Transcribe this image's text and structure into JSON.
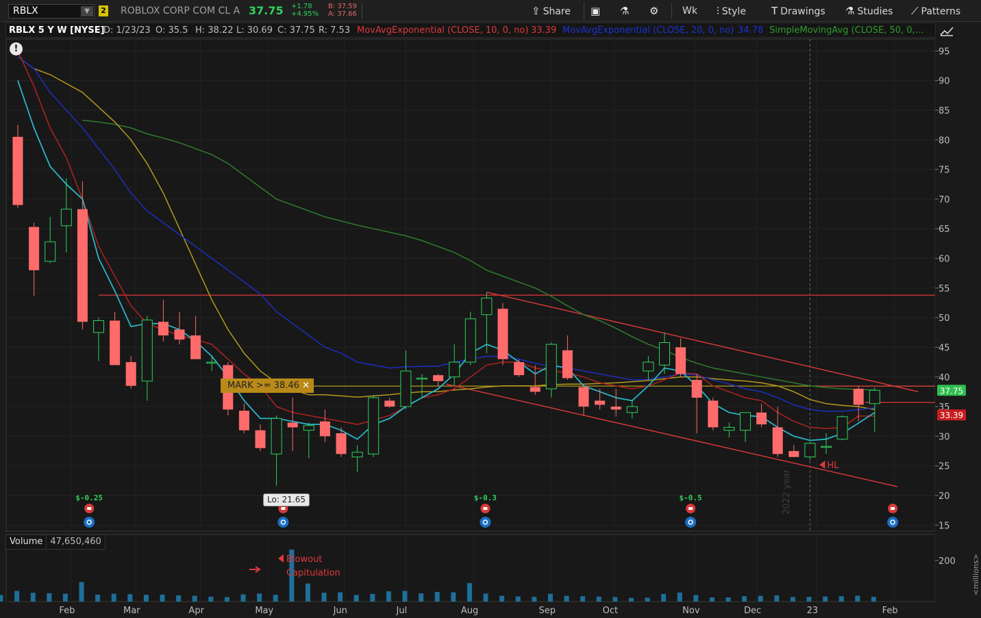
{
  "toolbar": {
    "symbol": "RBLX",
    "link_number": "2",
    "company": "ROBLOX CORP COM CL A",
    "last": "37.75",
    "change": "+1.78",
    "change_pct": "+4.95%",
    "bid": "B: 37.59",
    "ask": "A: 37.66",
    "share_label": "Share",
    "aggregation_label": "Wk",
    "style_label": "Style",
    "drawings_label": "Drawings",
    "studies_label": "Studies",
    "patterns_label": "Patterns"
  },
  "study_bar": {
    "title": "RBLX 5 Y W [NYSE]",
    "date": "D: 1/23/23",
    "open": "O: 35.5",
    "high": "H: 38.22",
    "low": "L: 30.69",
    "close": "C: 37.75",
    "range": "R: 7.53",
    "ema10_label": "MovAvgExponential (CLOSE, 10, 0, no)",
    "ema10_value": "33.39",
    "ema20_label": "MovAvgExponential (CLOSE, 20, 0, no)",
    "ema20_value": "34.78",
    "sma50_label": "SimpleMovingAvg (CLOSE, 50, 0,..."
  },
  "annotations": {
    "mark_label": "MARK >= 38.46",
    "low_label": "Lo: 21.65",
    "hl_label": "HL",
    "blowout_label": "Blowout",
    "capitulation_label": "Capitulation",
    "year_label": "2022 year",
    "price_tag_last": "37.75",
    "price_tag_ema": "33.39",
    "earnings": [
      "$-0.25",
      "$-",
      "$-0.3",
      "$-0.5"
    ]
  },
  "volume_panel": {
    "label": "Volume",
    "value": "47,650,460",
    "axis_label": "200",
    "unit_label": "<millions>"
  },
  "colors": {
    "up": "#2fd15d",
    "down": "#ff6b6b",
    "ema10": "#b22222",
    "ema20": "#1c2fc0",
    "sma50": "#2e7d2e",
    "sma_gold": "#b59a1c",
    "ema_teal": "#2ab5c8",
    "volume": "#1e6f9a"
  },
  "chart_data": {
    "type": "candlestick",
    "symbol": "RBLX",
    "period": "weekly",
    "y_ticks": [
      15,
      20,
      25,
      30,
      35,
      40,
      45,
      50,
      55,
      60,
      65,
      70,
      75,
      80,
      85,
      90,
      95
    ],
    "ylim": [
      14,
      97
    ],
    "x_labels": [
      "Feb",
      "Mar",
      "Apr",
      "May",
      "Jun",
      "Jul",
      "Aug",
      "Sep",
      "Oct",
      "Nov",
      "Dec",
      "23",
      "Feb"
    ],
    "x_label_weeks": [
      3.3,
      7.3,
      11.3,
      15.5,
      20.2,
      24.0,
      28.2,
      33.0,
      36.9,
      41.9,
      45.7,
      49.4,
      54.2
    ],
    "candles": [
      {
        "o": 80.5,
        "h": 82.5,
        "l": 68.5,
        "c": 69.0
      },
      {
        "o": 65.3,
        "h": 66.0,
        "l": 53.7,
        "c": 58.0
      },
      {
        "o": 59.5,
        "h": 67.0,
        "l": 59.2,
        "c": 62.8
      },
      {
        "o": 65.5,
        "h": 73.5,
        "l": 61.0,
        "c": 68.3
      },
      {
        "o": 68.3,
        "h": 73.0,
        "l": 48.0,
        "c": 49.3
      },
      {
        "o": 47.5,
        "h": 50.0,
        "l": 42.7,
        "c": 49.5
      },
      {
        "o": 49.5,
        "h": 51.0,
        "l": 42.0,
        "c": 42.0
      },
      {
        "o": 42.5,
        "h": 43.5,
        "l": 38.0,
        "c": 38.5
      },
      {
        "o": 39.3,
        "h": 50.3,
        "l": 36.0,
        "c": 49.6
      },
      {
        "o": 49.3,
        "h": 53.0,
        "l": 46.0,
        "c": 47.0
      },
      {
        "o": 48.0,
        "h": 51.0,
        "l": 45.5,
        "c": 46.3
      },
      {
        "o": 47.0,
        "h": 50.3,
        "l": 44.5,
        "c": 43.0
      },
      {
        "o": 42.5,
        "h": 43.5,
        "l": 41.0,
        "c": 42.5
      },
      {
        "o": 42.0,
        "h": 42.5,
        "l": 33.5,
        "c": 34.5
      },
      {
        "o": 34.3,
        "h": 35.5,
        "l": 30.5,
        "c": 31.0
      },
      {
        "o": 31.0,
        "h": 32.0,
        "l": 27.5,
        "c": 28.0
      },
      {
        "o": 27.0,
        "h": 33.5,
        "l": 21.65,
        "c": 33.0
      },
      {
        "o": 32.3,
        "h": 36.5,
        "l": 27.5,
        "c": 31.5
      },
      {
        "o": 31.0,
        "h": 32.3,
        "l": 26.3,
        "c": 31.8
      },
      {
        "o": 32.5,
        "h": 34.5,
        "l": 29.0,
        "c": 30.0
      },
      {
        "o": 30.5,
        "h": 31.5,
        "l": 26.5,
        "c": 27.0
      },
      {
        "o": 26.5,
        "h": 28.5,
        "l": 24.0,
        "c": 27.3
      },
      {
        "o": 27.0,
        "h": 37.0,
        "l": 26.5,
        "c": 36.5
      },
      {
        "o": 36.0,
        "h": 36.5,
        "l": 34.8,
        "c": 35.0
      },
      {
        "o": 35.0,
        "h": 44.5,
        "l": 34.5,
        "c": 41.0
      },
      {
        "o": 39.8,
        "h": 40.5,
        "l": 36.5,
        "c": 39.8
      },
      {
        "o": 40.3,
        "h": 40.5,
        "l": 38.5,
        "c": 39.3
      },
      {
        "o": 40.0,
        "h": 45.5,
        "l": 38.5,
        "c": 42.5
      },
      {
        "o": 42.5,
        "h": 51.0,
        "l": 42.0,
        "c": 49.8
      },
      {
        "o": 50.5,
        "h": 54.3,
        "l": 44.0,
        "c": 53.3
      },
      {
        "o": 51.5,
        "h": 52.5,
        "l": 42.0,
        "c": 43.0
      },
      {
        "o": 42.5,
        "h": 43.0,
        "l": 40.0,
        "c": 40.3
      },
      {
        "o": 38.3,
        "h": 42.0,
        "l": 37.0,
        "c": 37.5
      },
      {
        "o": 38.0,
        "h": 45.8,
        "l": 36.5,
        "c": 45.5
      },
      {
        "o": 44.5,
        "h": 47.0,
        "l": 39.5,
        "c": 39.8
      },
      {
        "o": 38.3,
        "h": 38.8,
        "l": 33.5,
        "c": 35.0
      },
      {
        "o": 36.0,
        "h": 38.0,
        "l": 34.5,
        "c": 35.3
      },
      {
        "o": 35.0,
        "h": 38.0,
        "l": 33.3,
        "c": 34.5
      },
      {
        "o": 34.0,
        "h": 36.0,
        "l": 33.0,
        "c": 35.0
      },
      {
        "o": 41.0,
        "h": 43.5,
        "l": 39.5,
        "c": 42.5
      },
      {
        "o": 42.0,
        "h": 47.5,
        "l": 40.5,
        "c": 45.8
      },
      {
        "o": 45.0,
        "h": 46.5,
        "l": 40.0,
        "c": 40.5
      },
      {
        "o": 39.5,
        "h": 40.5,
        "l": 30.5,
        "c": 36.5
      },
      {
        "o": 36.0,
        "h": 36.5,
        "l": 31.0,
        "c": 31.5
      },
      {
        "o": 31.0,
        "h": 32.3,
        "l": 29.8,
        "c": 31.5
      },
      {
        "o": 31.0,
        "h": 34.0,
        "l": 29.0,
        "c": 34.0
      },
      {
        "o": 34.0,
        "h": 35.5,
        "l": 31.5,
        "c": 32.0
      },
      {
        "o": 31.5,
        "h": 35.0,
        "l": 26.5,
        "c": 27.0
      },
      {
        "o": 27.5,
        "h": 28.5,
        "l": 26.5,
        "c": 26.5
      },
      {
        "o": 26.5,
        "h": 29.0,
        "l": 26.0,
        "c": 28.8
      },
      {
        "o": 28.3,
        "h": 30.5,
        "l": 27.0,
        "c": 28.3
      },
      {
        "o": 29.5,
        "h": 33.5,
        "l": 29.3,
        "c": 33.3
      },
      {
        "o": 38.0,
        "h": 38.5,
        "l": 32.5,
        "c": 35.3
      },
      {
        "o": 35.5,
        "h": 38.22,
        "l": 30.69,
        "c": 37.75
      }
    ],
    "volume": [
      32,
      52,
      43,
      41,
      38,
      95,
      34,
      38,
      36,
      33,
      34,
      30,
      28,
      24,
      22,
      35,
      39,
      33,
      260,
      88,
      43,
      45,
      32,
      37,
      50,
      52,
      40,
      47,
      45,
      90,
      39,
      28,
      25,
      23,
      38,
      28,
      26,
      24,
      22,
      18,
      19,
      37,
      44,
      32,
      20,
      20,
      26,
      28,
      30,
      22,
      23,
      25,
      26,
      29,
      23
    ],
    "volume_ylim": [
      0,
      240
    ],
    "ema10": [
      95,
      89,
      82,
      77,
      70,
      62,
      57,
      52,
      49,
      48,
      47,
      46.3,
      45.5,
      43,
      40.5,
      38.5,
      35,
      34,
      33.5,
      33,
      32.5,
      32,
      32.7,
      33.5,
      35,
      36.5,
      37,
      38,
      40,
      42,
      42.5,
      42.5,
      41.5,
      41,
      40.7,
      40,
      39,
      38.5,
      38,
      38.5,
      39.5,
      40.7,
      40.5,
      38.5,
      37.5,
      36.5,
      36,
      34,
      32.5,
      31.5,
      31.3,
      31.5,
      33.4,
      33.4
    ],
    "ema20": [
      94,
      92,
      88,
      85,
      82,
      78.5,
      75,
      71,
      68,
      66,
      64,
      62,
      60,
      58,
      56,
      54,
      51,
      49,
      47,
      45,
      44,
      42.5,
      42,
      41.5,
      41.7,
      41.8,
      41.8,
      42.5,
      43,
      43.5,
      43.5,
      43,
      42.3,
      41.8,
      41.5,
      41,
      40.5,
      40,
      39.5,
      39.6,
      40,
      40.5,
      40.3,
      39.5,
      38.8,
      38,
      37.5,
      36.5,
      35.3,
      34.5,
      34.2,
      34.2,
      34.5,
      34.78
    ],
    "ema_teal": [
      90,
      82,
      75.5,
      72.5,
      70,
      60,
      54.5,
      48.5,
      49,
      49,
      48,
      46,
      43.5,
      40,
      36,
      33,
      33,
      32.5,
      32,
      32,
      31,
      29.5,
      32,
      33,
      35,
      36.5,
      38,
      40.5,
      44,
      45.5,
      44.5,
      42.5,
      40.5,
      42,
      41.5,
      38.5,
      37.5,
      36.5,
      36,
      38.5,
      41.5,
      41,
      38.5,
      35.5,
      34,
      33.5,
      33.3,
      31.5,
      30,
      29.3,
      29.5,
      30.5,
      32.2,
      34.0
    ],
    "sma_gold": [
      94,
      92,
      91,
      89.5,
      88,
      85.5,
      83,
      80,
      76,
      71,
      65,
      59,
      53,
      48,
      44,
      41,
      39,
      37.8,
      37,
      37,
      36.8,
      36.6,
      36.8,
      37,
      37.3,
      37.5,
      37.5,
      37.8,
      38,
      38.3,
      38.5,
      38.5,
      38.5,
      38.7,
      38.8,
      38.8,
      38.9,
      39,
      39.2,
      39.4,
      39.7,
      40,
      40,
      39.7,
      39.5,
      39.3,
      39,
      38.5,
      37.5,
      36.2,
      35.5,
      35.2,
      35,
      34.5
    ],
    "sma50": [
      null,
      null,
      null,
      null,
      83.3,
      83,
      82.6,
      82,
      81,
      80.3,
      79.5,
      78.5,
      77.5,
      76,
      74,
      72,
      70,
      69,
      68,
      67,
      66.3,
      65.6,
      65,
      64.4,
      63.8,
      63,
      62,
      61,
      59.6,
      58,
      57,
      56,
      55,
      53.6,
      52,
      50.5,
      49.5,
      48.2,
      46.8,
      45.5,
      44.5,
      43.3,
      42.3,
      41.5,
      41,
      40.5,
      40,
      39.5,
      39,
      38.5,
      38.2,
      38,
      37.9,
      37.8
    ],
    "h_lines": [
      {
        "value": 53.8,
        "from_week": 5,
        "color": "#e0383b"
      },
      {
        "value": 38.46,
        "from_week": 13,
        "color": "#b59a1c"
      },
      {
        "value": 38.46,
        "from_week": 49.5,
        "color": "#e0383b"
      },
      {
        "value": 35.7,
        "from_week": 52.4,
        "color": "#e0383b"
      }
    ],
    "trend_lines": [
      {
        "from": [
          29.0,
          54.3
        ],
        "to": [
          55.7,
          37.5
        ]
      },
      {
        "from": [
          26.5,
          38.8
        ],
        "to": [
          54.4,
          21.5
        ]
      }
    ],
    "earnings_weeks": [
      4.5,
      16.5,
      29.0,
      41.7,
      54.2
    ],
    "year_divider_week": 49.0
  }
}
